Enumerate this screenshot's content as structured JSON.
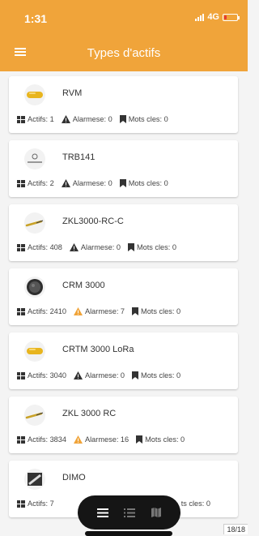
{
  "status_bar": {
    "time": "1:31",
    "network": "4G"
  },
  "header": {
    "title": "Types d'actifs"
  },
  "assets": [
    {
      "name": "RVM",
      "icon": "yellow-capsule-device",
      "actifs": "Actifs: 1",
      "alarmes": "Alarmese: 0",
      "mots": "Mots cles: 0",
      "alarm_active": false
    },
    {
      "name": "TRB141",
      "icon": "gateway-logo",
      "actifs": "Actifs: 2",
      "alarmes": "Alarmese: 0",
      "mots": "Mots cles: 0",
      "alarm_active": false
    },
    {
      "name": "ZKL3000-RC-C",
      "icon": "rail-clip-device",
      "actifs": "Actifs: 408",
      "alarmes": "Alarmese: 0",
      "mots": "Mots cles: 0",
      "alarm_active": false
    },
    {
      "name": "CRM 3000",
      "icon": "round-sensor-device",
      "actifs": "Actifs: 2410",
      "alarmes": "Alarmese: 7",
      "mots": "Mots cles: 0",
      "alarm_active": true
    },
    {
      "name": "CRTM 3000 LoRa",
      "icon": "yellow-capsule-device",
      "actifs": "Actifs: 3040",
      "alarmes": "Alarmese: 0",
      "mots": "Mots cles: 0",
      "alarm_active": false
    },
    {
      "name": "ZKL 3000 RC",
      "icon": "rail-clip-device",
      "actifs": "Actifs: 3834",
      "alarmes": "Alarmese: 16",
      "mots": "Mots cles: 0",
      "alarm_active": true
    },
    {
      "name": "DIMO",
      "icon": "box-device",
      "actifs": "Actifs: 7",
      "alarmes": "",
      "mots": "ts cles: 0",
      "alarm_active": false
    }
  ],
  "bottom_nav": {
    "items": [
      {
        "icon": "hamburger-icon",
        "active": true
      },
      {
        "icon": "list-icon",
        "active": false
      },
      {
        "icon": "map-icon",
        "active": false
      }
    ]
  },
  "pager": "18/18",
  "colors": {
    "accent": "#f0a43a",
    "alarm_active": "#f0a43a",
    "alarm_inactive": "#333333"
  }
}
